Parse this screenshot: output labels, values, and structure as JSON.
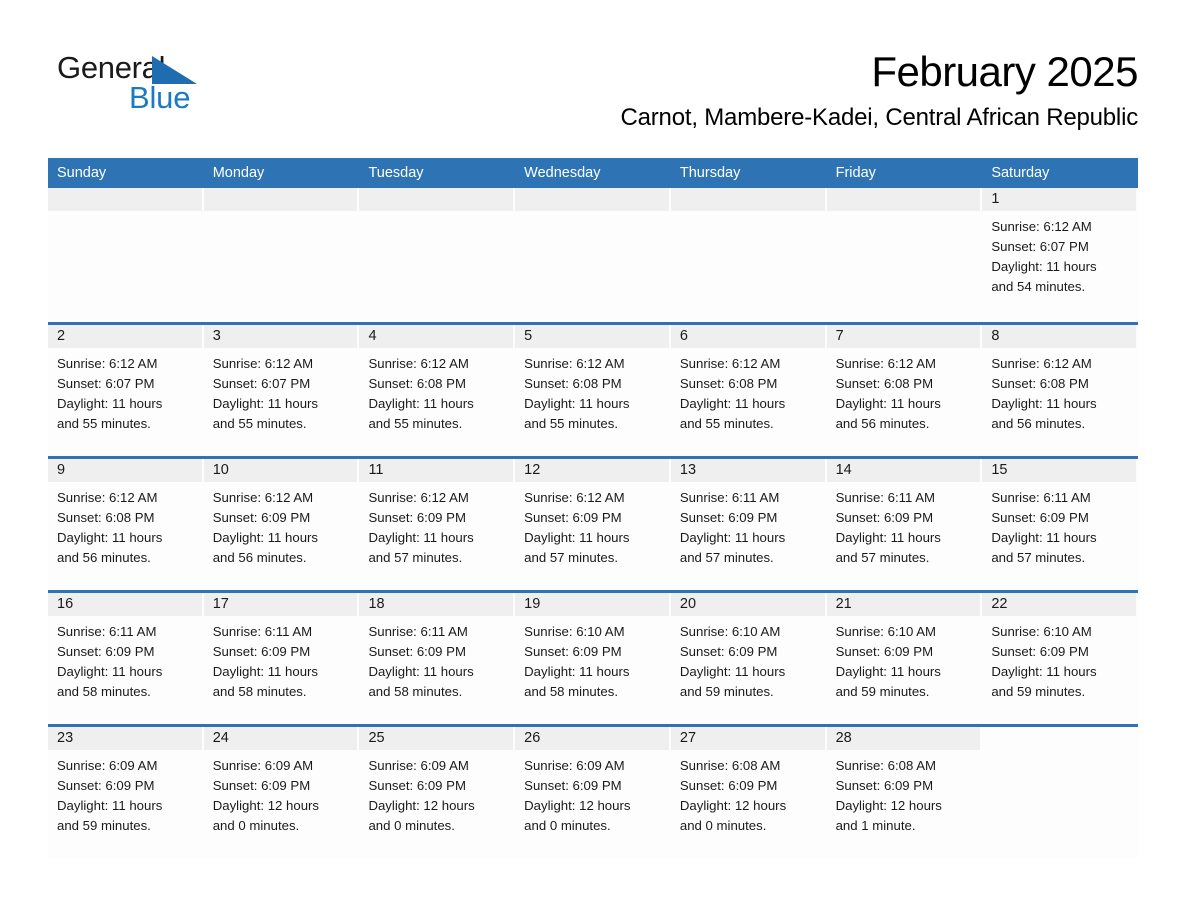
{
  "brand": {
    "name_part1": "General",
    "name_part2": "Blue",
    "logo_icon": "triangle-flag-icon"
  },
  "header": {
    "title": "February 2025",
    "subtitle": "Carnot, Mambere-Kadei, Central African Republic"
  },
  "colors": {
    "header_blue": "#2e74b5",
    "brand_blue": "#1b7ac4",
    "date_band_gray": "#efefef"
  },
  "weekdays": [
    "Sunday",
    "Monday",
    "Tuesday",
    "Wednesday",
    "Thursday",
    "Friday",
    "Saturday"
  ],
  "weeks": [
    [
      {
        "day": "",
        "lines": []
      },
      {
        "day": "",
        "lines": []
      },
      {
        "day": "",
        "lines": []
      },
      {
        "day": "",
        "lines": []
      },
      {
        "day": "",
        "lines": []
      },
      {
        "day": "",
        "lines": []
      },
      {
        "day": "1",
        "lines": [
          "Sunrise: 6:12 AM",
          "Sunset: 6:07 PM",
          "Daylight: 11 hours",
          "and 54 minutes."
        ]
      }
    ],
    [
      {
        "day": "2",
        "lines": [
          "Sunrise: 6:12 AM",
          "Sunset: 6:07 PM",
          "Daylight: 11 hours",
          "and 55 minutes."
        ]
      },
      {
        "day": "3",
        "lines": [
          "Sunrise: 6:12 AM",
          "Sunset: 6:07 PM",
          "Daylight: 11 hours",
          "and 55 minutes."
        ]
      },
      {
        "day": "4",
        "lines": [
          "Sunrise: 6:12 AM",
          "Sunset: 6:08 PM",
          "Daylight: 11 hours",
          "and 55 minutes."
        ]
      },
      {
        "day": "5",
        "lines": [
          "Sunrise: 6:12 AM",
          "Sunset: 6:08 PM",
          "Daylight: 11 hours",
          "and 55 minutes."
        ]
      },
      {
        "day": "6",
        "lines": [
          "Sunrise: 6:12 AM",
          "Sunset: 6:08 PM",
          "Daylight: 11 hours",
          "and 55 minutes."
        ]
      },
      {
        "day": "7",
        "lines": [
          "Sunrise: 6:12 AM",
          "Sunset: 6:08 PM",
          "Daylight: 11 hours",
          "and 56 minutes."
        ]
      },
      {
        "day": "8",
        "lines": [
          "Sunrise: 6:12 AM",
          "Sunset: 6:08 PM",
          "Daylight: 11 hours",
          "and 56 minutes."
        ]
      }
    ],
    [
      {
        "day": "9",
        "lines": [
          "Sunrise: 6:12 AM",
          "Sunset: 6:08 PM",
          "Daylight: 11 hours",
          "and 56 minutes."
        ]
      },
      {
        "day": "10",
        "lines": [
          "Sunrise: 6:12 AM",
          "Sunset: 6:09 PM",
          "Daylight: 11 hours",
          "and 56 minutes."
        ]
      },
      {
        "day": "11",
        "lines": [
          "Sunrise: 6:12 AM",
          "Sunset: 6:09 PM",
          "Daylight: 11 hours",
          "and 57 minutes."
        ]
      },
      {
        "day": "12",
        "lines": [
          "Sunrise: 6:12 AM",
          "Sunset: 6:09 PM",
          "Daylight: 11 hours",
          "and 57 minutes."
        ]
      },
      {
        "day": "13",
        "lines": [
          "Sunrise: 6:11 AM",
          "Sunset: 6:09 PM",
          "Daylight: 11 hours",
          "and 57 minutes."
        ]
      },
      {
        "day": "14",
        "lines": [
          "Sunrise: 6:11 AM",
          "Sunset: 6:09 PM",
          "Daylight: 11 hours",
          "and 57 minutes."
        ]
      },
      {
        "day": "15",
        "lines": [
          "Sunrise: 6:11 AM",
          "Sunset: 6:09 PM",
          "Daylight: 11 hours",
          "and 57 minutes."
        ]
      }
    ],
    [
      {
        "day": "16",
        "lines": [
          "Sunrise: 6:11 AM",
          "Sunset: 6:09 PM",
          "Daylight: 11 hours",
          "and 58 minutes."
        ]
      },
      {
        "day": "17",
        "lines": [
          "Sunrise: 6:11 AM",
          "Sunset: 6:09 PM",
          "Daylight: 11 hours",
          "and 58 minutes."
        ]
      },
      {
        "day": "18",
        "lines": [
          "Sunrise: 6:11 AM",
          "Sunset: 6:09 PM",
          "Daylight: 11 hours",
          "and 58 minutes."
        ]
      },
      {
        "day": "19",
        "lines": [
          "Sunrise: 6:10 AM",
          "Sunset: 6:09 PM",
          "Daylight: 11 hours",
          "and 58 minutes."
        ]
      },
      {
        "day": "20",
        "lines": [
          "Sunrise: 6:10 AM",
          "Sunset: 6:09 PM",
          "Daylight: 11 hours",
          "and 59 minutes."
        ]
      },
      {
        "day": "21",
        "lines": [
          "Sunrise: 6:10 AM",
          "Sunset: 6:09 PM",
          "Daylight: 11 hours",
          "and 59 minutes."
        ]
      },
      {
        "day": "22",
        "lines": [
          "Sunrise: 6:10 AM",
          "Sunset: 6:09 PM",
          "Daylight: 11 hours",
          "and 59 minutes."
        ]
      }
    ],
    [
      {
        "day": "23",
        "lines": [
          "Sunrise: 6:09 AM",
          "Sunset: 6:09 PM",
          "Daylight: 11 hours",
          "and 59 minutes."
        ]
      },
      {
        "day": "24",
        "lines": [
          "Sunrise: 6:09 AM",
          "Sunset: 6:09 PM",
          "Daylight: 12 hours",
          "and 0 minutes."
        ]
      },
      {
        "day": "25",
        "lines": [
          "Sunrise: 6:09 AM",
          "Sunset: 6:09 PM",
          "Daylight: 12 hours",
          "and 0 minutes."
        ]
      },
      {
        "day": "26",
        "lines": [
          "Sunrise: 6:09 AM",
          "Sunset: 6:09 PM",
          "Daylight: 12 hours",
          "and 0 minutes."
        ]
      },
      {
        "day": "27",
        "lines": [
          "Sunrise: 6:08 AM",
          "Sunset: 6:09 PM",
          "Daylight: 12 hours",
          "and 0 minutes."
        ]
      },
      {
        "day": "28",
        "lines": [
          "Sunrise: 6:08 AM",
          "Sunset: 6:09 PM",
          "Daylight: 12 hours",
          "and 1 minute."
        ]
      },
      {
        "day": "",
        "lines": []
      }
    ]
  ]
}
